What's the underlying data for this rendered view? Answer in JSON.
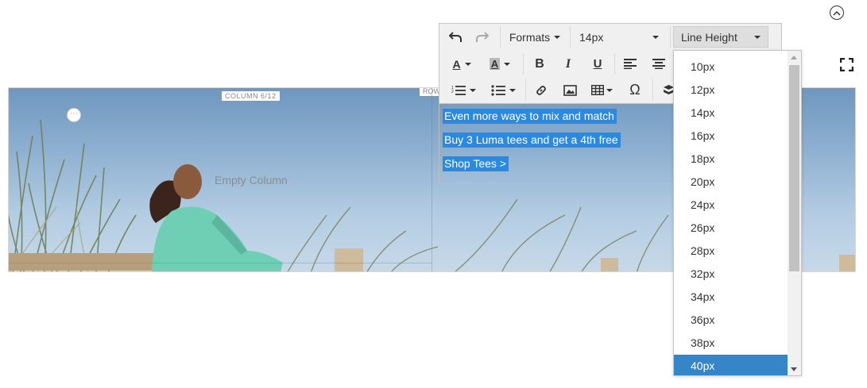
{
  "stage": {
    "column_label": "COLUMN 6/12",
    "row_label": "ROW",
    "empty_column": "Empty Column"
  },
  "content": {
    "lines": [
      "Even more ways to mix and match",
      "Buy 3 Luma tees and get a 4th free",
      "Shop Tees >"
    ]
  },
  "toolbar": {
    "formats_label": "Formats",
    "font_size": "14px",
    "line_height_label": "Line Height",
    "icons": [
      "undo-icon",
      "redo-icon",
      "text-color-icon",
      "background-color-icon",
      "bold-icon",
      "italic-icon",
      "underline-icon",
      "align-left-icon",
      "align-center-icon",
      "numbered-list-icon",
      "bullet-list-icon",
      "link-icon",
      "image-icon",
      "table-icon",
      "special-character-icon",
      "widget-icon"
    ]
  },
  "line_height_menu": {
    "options": [
      "10px",
      "12px",
      "14px",
      "16px",
      "18px",
      "20px",
      "24px",
      "26px",
      "28px",
      "32px",
      "34px",
      "36px",
      "38px",
      "40px"
    ],
    "selected": "40px"
  },
  "colors": {
    "selection": "#2a8ae3",
    "menu_active": "#3585c8",
    "toolbar_bg": "#f0f0f0"
  }
}
